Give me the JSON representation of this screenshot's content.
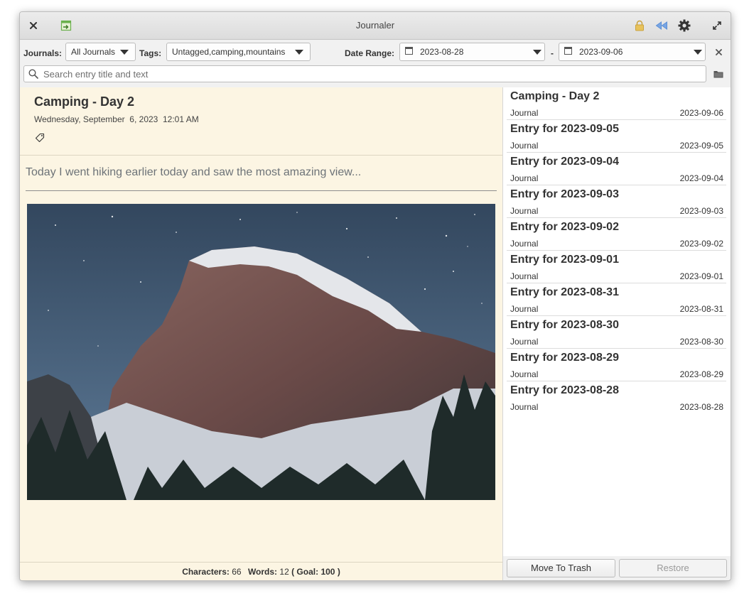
{
  "window": {
    "title": "Journaler"
  },
  "filters": {
    "journals_label": "Journals:",
    "journals_value": "All Journals",
    "tags_label": "Tags:",
    "tags_value": "Untagged,camping,mountains",
    "date_range_label": "Date Range:",
    "date_from": "2023-08-28",
    "date_separator": "-",
    "date_to": "2023-09-06"
  },
  "search": {
    "placeholder": "Search entry title and text"
  },
  "entry": {
    "title": "Camping - Day 2",
    "datetime": "Wednesday, September  6, 2023  12:01 AM",
    "text": "Today I went hiking earlier today and saw the most amazing view...",
    "image_subject": "snow-dusted granite dome under a starry night sky with pine trees"
  },
  "status": {
    "characters_label": "Characters:",
    "characters_value": "66",
    "words_label": "Words:",
    "words_value": "12",
    "goal_open": "( Goal:",
    "goal_value": "100",
    "goal_close": ")"
  },
  "entries": [
    {
      "title": "Camping - Day 2",
      "journal": "Journal",
      "date": "2023-09-06"
    },
    {
      "title": "Entry for 2023-09-05",
      "journal": "Journal",
      "date": "2023-09-05"
    },
    {
      "title": "Entry for 2023-09-04",
      "journal": "Journal",
      "date": "2023-09-04"
    },
    {
      "title": "Entry for 2023-09-03",
      "journal": "Journal",
      "date": "2023-09-03"
    },
    {
      "title": "Entry for 2023-09-02",
      "journal": "Journal",
      "date": "2023-09-02"
    },
    {
      "title": "Entry for 2023-09-01",
      "journal": "Journal",
      "date": "2023-09-01"
    },
    {
      "title": "Entry for 2023-08-31",
      "journal": "Journal",
      "date": "2023-08-31"
    },
    {
      "title": "Entry for 2023-08-30",
      "journal": "Journal",
      "date": "2023-08-30"
    },
    {
      "title": "Entry for 2023-08-29",
      "journal": "Journal",
      "date": "2023-08-29"
    },
    {
      "title": "Entry for 2023-08-28",
      "journal": "Journal",
      "date": "2023-08-28"
    }
  ],
  "actions": {
    "move_to_trash": "Move To Trash",
    "restore": "Restore"
  },
  "icons": {
    "close": "close-icon",
    "new_entry": "new-entry-icon",
    "lock": "lock-icon",
    "rewind": "rewind-icon",
    "settings": "gear-icon",
    "maximize": "maximize-icon",
    "search": "search-icon",
    "folder": "folder-icon",
    "tag": "tag-icon",
    "calendar": "calendar-icon",
    "clear": "clear-filter-icon"
  },
  "colors": {
    "editor_bg": "#fcf5e3",
    "lock": "#e0b84a",
    "rewind": "#5b8fd6",
    "new_entry": "#6ab04c"
  }
}
